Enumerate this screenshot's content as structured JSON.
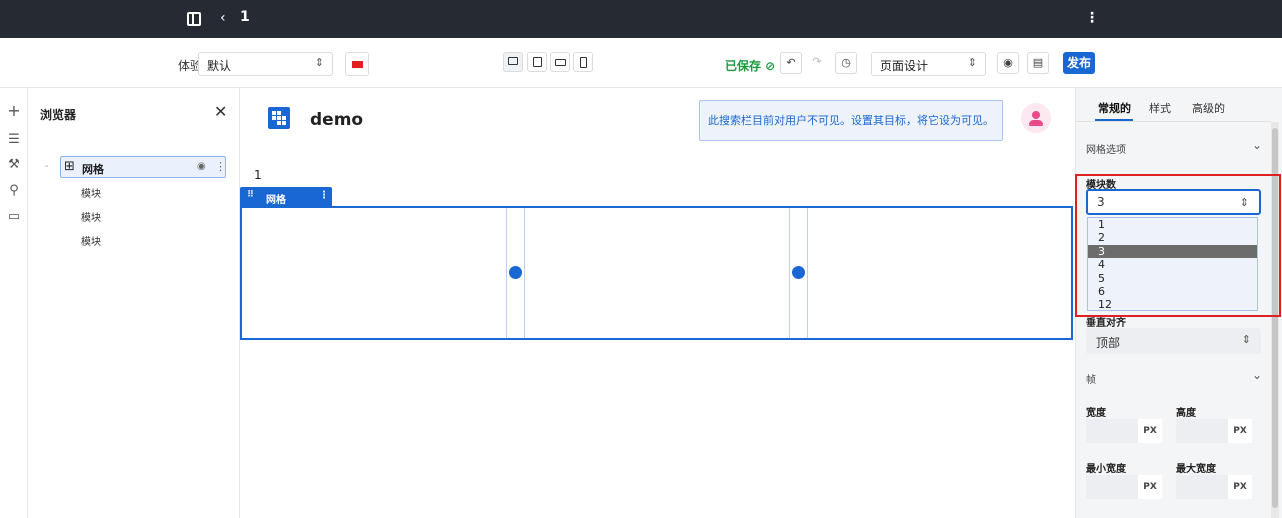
{
  "topbar": {
    "back_glyph": "‹",
    "title": "1",
    "more_glyph": "⋮"
  },
  "toolbar": {
    "experience_label": "体验",
    "experience_value": "默认",
    "saved_text": "已保存 ⊘",
    "page_select_value": "页面设计",
    "publish_label": "发布",
    "undo_glyph": "↶",
    "redo_glyph": "↷",
    "history_glyph": "◷",
    "preview_glyph": "◉",
    "pages_glyph": "▤"
  },
  "rail": {
    "icons": [
      "plus-icon",
      "layers-icon",
      "paint-icon",
      "link-icon",
      "comment-icon"
    ]
  },
  "browser": {
    "title": "浏览器",
    "close_glyph": "✕",
    "root": {
      "label": "网格",
      "icon_glyph": "⊞",
      "eye_glyph": "◉",
      "dots_glyph": "⋮",
      "caret_glyph": "-"
    },
    "children": [
      "模块",
      "模块",
      "模块"
    ]
  },
  "canvas": {
    "title": "demo",
    "notice": "此搜索栏目前对用户不可见。设置其目标，将它设为可见。",
    "page_number": "1",
    "grid_tag": {
      "handle": "⠿",
      "label": "网格",
      "dots": "⋮"
    }
  },
  "right_panel": {
    "tabs": [
      "常规的",
      "样式",
      "高级的"
    ],
    "active_tab": "常规的",
    "grid_options_label": "网格选项",
    "module_count_label": "模块数",
    "module_count_value": "3",
    "module_count_options": [
      "1",
      "2",
      "3",
      "4",
      "5",
      "6",
      "12"
    ],
    "vertical_align_label": "垂直对齐",
    "vertical_align_value": "顶部",
    "frame_label": "帧",
    "width_label": "宽度",
    "height_label": "高度",
    "min_width_label": "最小宽度",
    "max_width_label": "最大宽度",
    "unit": "PX"
  },
  "colors": {
    "accent": "#1967d2",
    "topbar": "#262a33",
    "highlight": "#e02020",
    "saved": "#1a9a3c"
  }
}
